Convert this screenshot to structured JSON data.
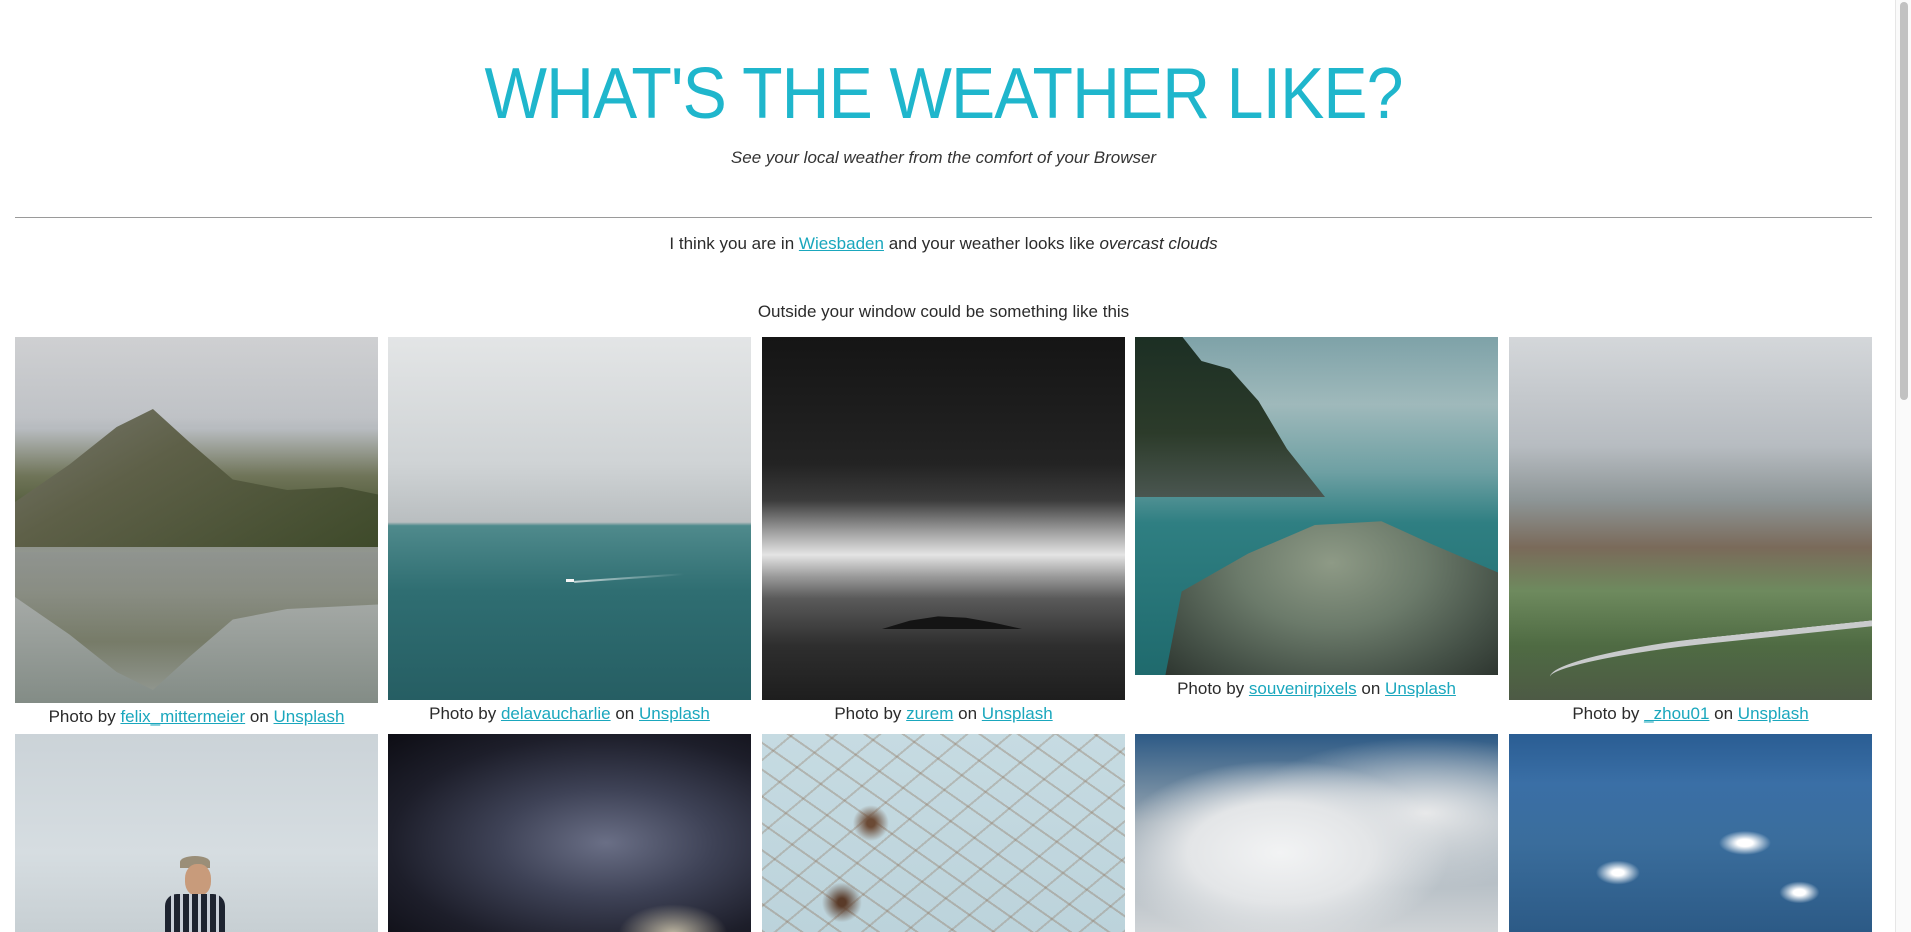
{
  "header": {
    "title": "WHAT'S THE WEATHER LIKE?",
    "subtitle": "See your local weather from the comfort of your Browser"
  },
  "location": {
    "prefix": "I think you are in",
    "city": "Wiesbaden",
    "middle": "and your weather looks like",
    "condition": "overcast clouds"
  },
  "outside_text": "Outside your window could be something like this",
  "credit": {
    "photo_by": "Photo by",
    "on": "on",
    "platform": "Unsplash"
  },
  "photos": [
    {
      "author": "felix_mittermeier"
    },
    {
      "author": "delavaucharlie"
    },
    {
      "author": "zurem"
    },
    {
      "author": "souvenirpixels"
    },
    {
      "author": "_zhou01"
    },
    {
      "author": ""
    },
    {
      "author": ""
    },
    {
      "author": ""
    },
    {
      "author": ""
    },
    {
      "author": ""
    }
  ],
  "colors": {
    "accent": "#1fb6cc",
    "link": "#1aa7bd"
  }
}
